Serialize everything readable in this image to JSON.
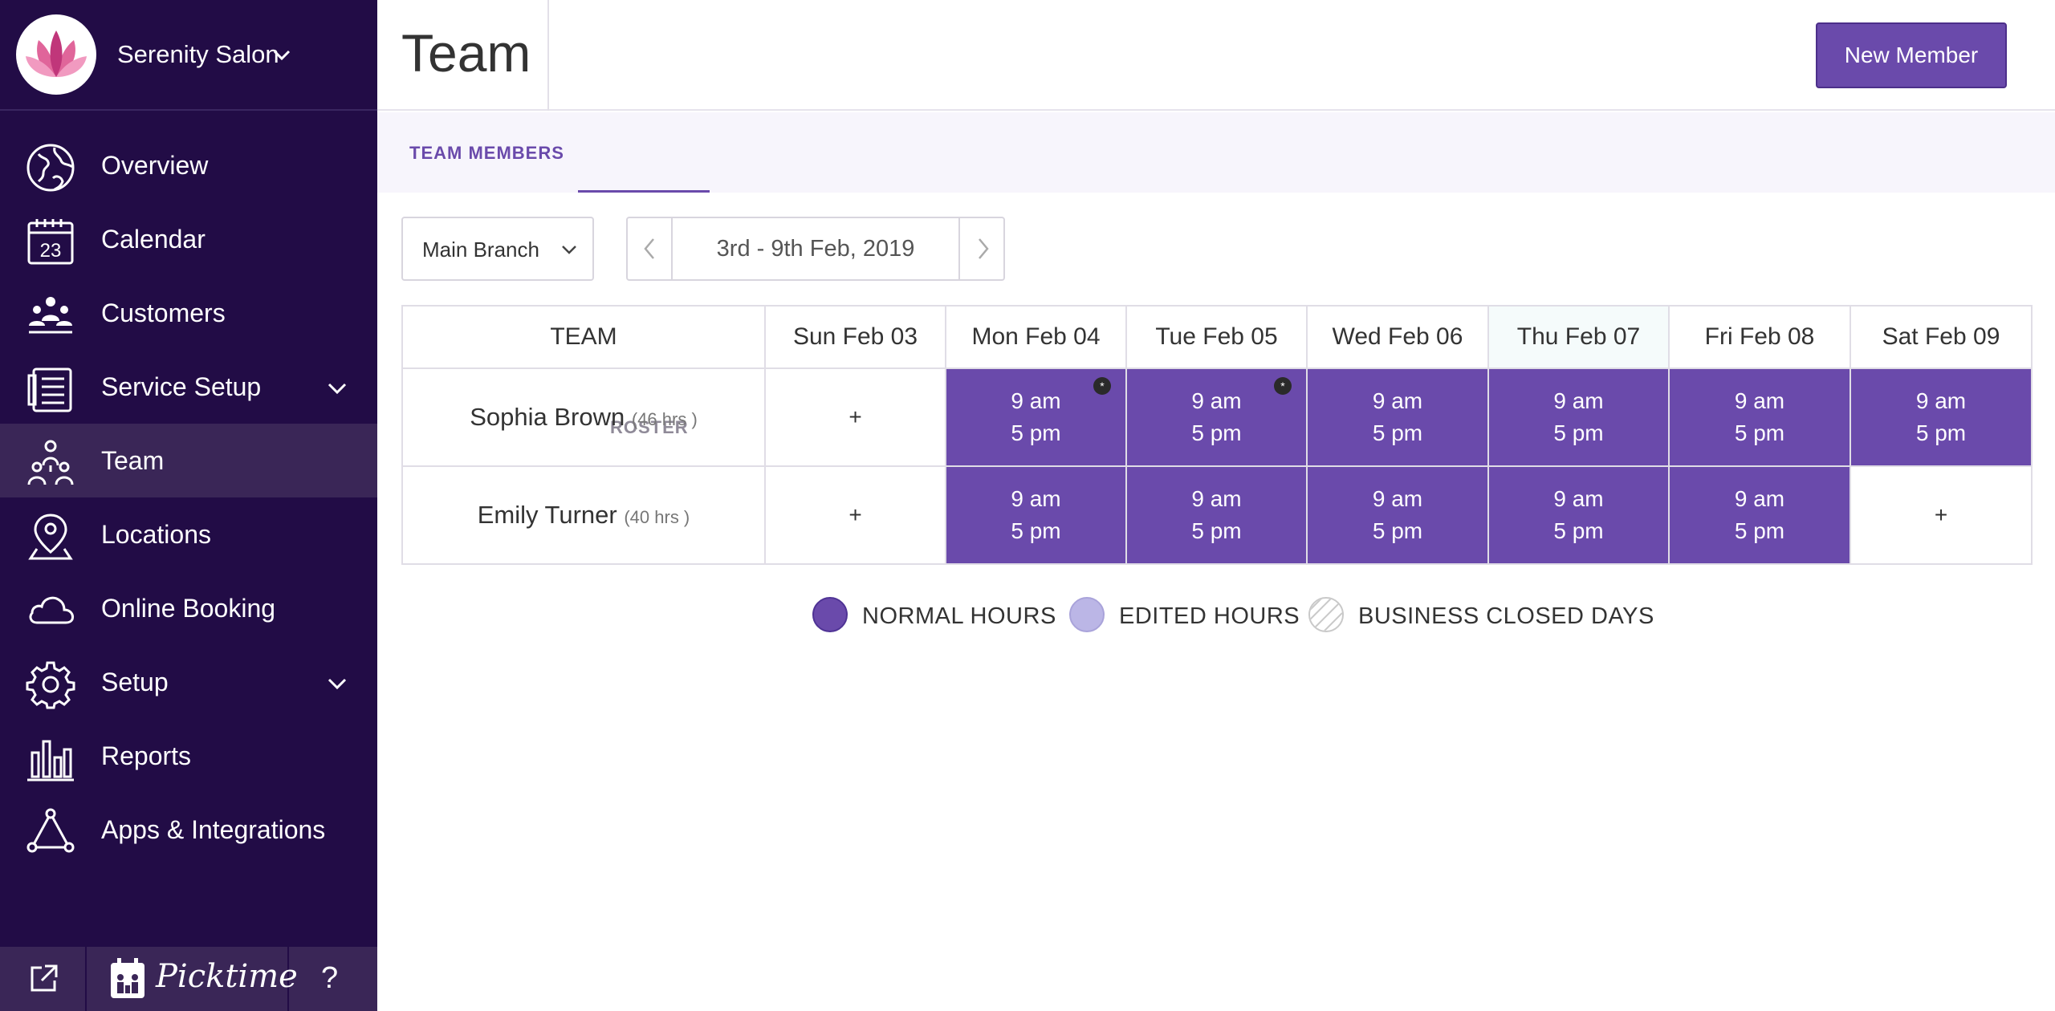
{
  "sidebar": {
    "salon_name": "Serenity Salon",
    "items": [
      {
        "label": "Overview",
        "icon": "globe-icon"
      },
      {
        "label": "Calendar",
        "icon": "calendar-icon"
      },
      {
        "label": "Customers",
        "icon": "customers-icon"
      },
      {
        "label": "Service Setup",
        "icon": "service-list-icon"
      },
      {
        "label": "Team",
        "icon": "team-icon"
      },
      {
        "label": "Locations",
        "icon": "location-pin-icon"
      },
      {
        "label": "Online Booking",
        "icon": "cloud-icon"
      },
      {
        "label": "Setup",
        "icon": "gear-icon"
      },
      {
        "label": "Reports",
        "icon": "bar-chart-icon"
      },
      {
        "label": "Apps & Integrations",
        "icon": "integrations-icon"
      }
    ],
    "active_item": "Team",
    "calendar_day": "23",
    "footer": {
      "logo": "Picktime",
      "help": "?"
    }
  },
  "header": {
    "title": "Team",
    "new_member_label": "New Member"
  },
  "tabs": [
    {
      "label": "TEAM MEMBERS",
      "active": false
    },
    {
      "label": "ROSTER",
      "active": true
    }
  ],
  "controls": {
    "branch": "Main Branch",
    "date_range": "3rd - 9th Feb, 2019"
  },
  "roster": {
    "columns": [
      "TEAM",
      "Sun Feb 03",
      "Mon Feb 04",
      "Tue Feb 05",
      "Wed Feb 06",
      "Thu Feb 07",
      "Fri Feb 08",
      "Sat Feb 09"
    ],
    "rows": [
      {
        "name": "Sophia Brown",
        "hours": "(46 hrs )",
        "cells": [
          {
            "type": "empty",
            "text": "+"
          },
          {
            "type": "shift",
            "start": "9 am",
            "end": "5 pm",
            "star": "*"
          },
          {
            "type": "shift",
            "start": "9 am",
            "end": "5 pm",
            "star": "*"
          },
          {
            "type": "shift",
            "start": "9 am",
            "end": "5 pm"
          },
          {
            "type": "shift",
            "start": "9 am",
            "end": "5 pm"
          },
          {
            "type": "shift",
            "start": "9 am",
            "end": "5 pm"
          },
          {
            "type": "shift",
            "start": "9 am",
            "end": "5 pm"
          }
        ]
      },
      {
        "name": "Emily Turner",
        "hours": "(40 hrs )",
        "cells": [
          {
            "type": "empty",
            "text": "+"
          },
          {
            "type": "shift",
            "start": "9 am",
            "end": "5 pm"
          },
          {
            "type": "shift",
            "start": "9 am",
            "end": "5 pm"
          },
          {
            "type": "shift",
            "start": "9 am",
            "end": "5 pm"
          },
          {
            "type": "shift",
            "start": "9 am",
            "end": "5 pm"
          },
          {
            "type": "shift",
            "start": "9 am",
            "end": "5 pm"
          },
          {
            "type": "empty",
            "text": "+"
          }
        ]
      }
    ]
  },
  "legend": {
    "normal": "NORMAL HOURS",
    "edited": "EDITED HOURS",
    "closed": "BUSINESS CLOSED DAYS"
  },
  "colors": {
    "sidebar_bg": "#220c46",
    "accent": "#6a4aab",
    "edited": "#bbb6e6",
    "active_nav": "#3a2657"
  }
}
